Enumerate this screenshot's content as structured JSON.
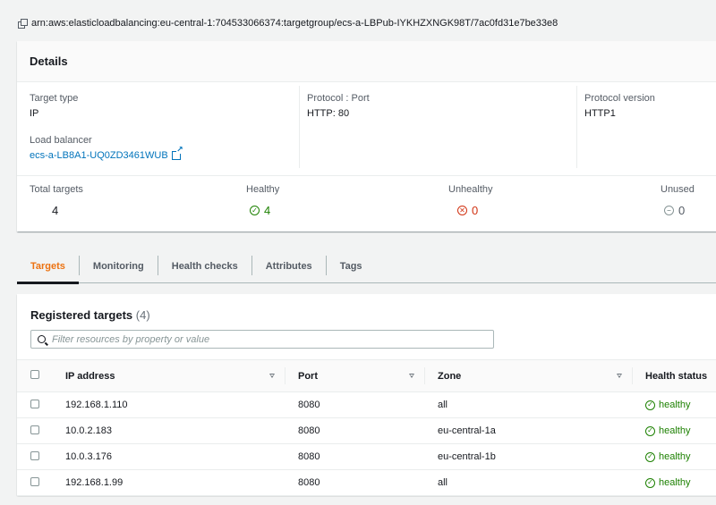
{
  "arn": "arn:aws:elasticloadbalancing:eu-central-1:704533066374:targetgroup/ecs-a-LBPub-IYKHZXNGK98T/7ac0fd31e7be33e8",
  "details": {
    "title": "Details",
    "target_type_label": "Target type",
    "target_type_value": "IP",
    "load_balancer_label": "Load balancer",
    "load_balancer_value": "ecs-a-LB8A1-UQ0ZD3461WUB",
    "protocol_port_label": "Protocol : Port",
    "protocol_port_value": "HTTP: 80",
    "protocol_version_label": "Protocol version",
    "protocol_version_value": "HTTP1",
    "total_targets_label": "Total targets",
    "total_targets_value": "4",
    "healthy_label": "Healthy",
    "healthy_value": "4",
    "unhealthy_label": "Unhealthy",
    "unhealthy_value": "0",
    "unused_label": "Unused",
    "unused_value": "0"
  },
  "tabs": [
    "Targets",
    "Monitoring",
    "Health checks",
    "Attributes",
    "Tags"
  ],
  "registered": {
    "title": "Registered targets",
    "count": "(4)",
    "filter_placeholder": "Filter resources by property or value",
    "columns": [
      "IP address",
      "Port",
      "Zone",
      "Health status"
    ],
    "rows": [
      {
        "ip": "192.168.1.110",
        "port": "8080",
        "zone": "all",
        "health": "healthy"
      },
      {
        "ip": "10.0.2.183",
        "port": "8080",
        "zone": "eu-central-1a",
        "health": "healthy"
      },
      {
        "ip": "10.0.3.176",
        "port": "8080",
        "zone": "eu-central-1b",
        "health": "healthy"
      },
      {
        "ip": "192.168.1.99",
        "port": "8080",
        "zone": "all",
        "health": "healthy"
      }
    ]
  },
  "colors": {
    "accent_tab": "#ec7211",
    "link": "#0073bb",
    "healthy": "#1d8102",
    "unhealthy": "#d13212",
    "neutral": "#879596"
  }
}
